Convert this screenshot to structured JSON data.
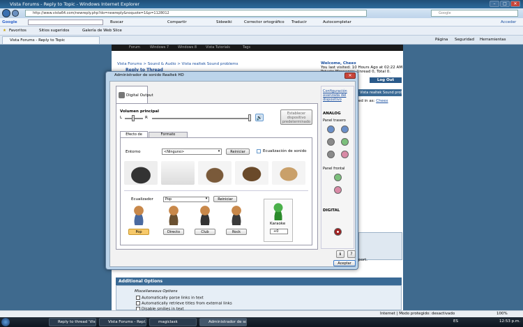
{
  "window": {
    "title": "Vista Forums - Reply to Topic - Windows Internet Explorer",
    "min": "–",
    "max": "□",
    "close": "✕"
  },
  "browser": {
    "address": "http://www.vista64.com/newreply.php?do=newreply&noquote=1&p=1128012",
    "search_placeholder": "Google",
    "google_label": "Google",
    "google_buttons": [
      "Buscar",
      "Compartir",
      "Sidewiki",
      "Corrector ortográfico",
      "Traducir",
      "Autocompletar"
    ],
    "signin": "Acceder",
    "favorites": "Favoritos",
    "sugeridos": "Sitios sugeridos",
    "galeria": "Galería de Web Slice",
    "tab_title": "Vista Forums - Reply to Topic",
    "menus": [
      "Página",
      "Seguridad",
      "Herramientas"
    ]
  },
  "forum": {
    "nav": [
      "Forum",
      "Windows 7",
      "Windows 8",
      "Vista Tutorials",
      "Tags"
    ],
    "breadcrumb": "Vista Forums > Sound & Audio > Vista realtek Sound problems",
    "reply_title": "Reply to Thread",
    "welcome": "Welcome,",
    "username": "Cheex",
    "last_visit": "You last visited: 10 Hours Ago at 02:22 AM",
    "pm": "Private Messages: Unread 0, Total 0.",
    "logout": "Log Out",
    "thread_box": "Vista realtek Sound problems",
    "logged_in": "ed in as: ",
    "logged_user": "Cheex",
    "support_frag": "port.",
    "additional": "Additional Options",
    "misc": "Miscellaneous Options",
    "options": [
      "Automatically parse links in text",
      "Automatically retrieve titles from external links",
      "Disable smilies in text"
    ]
  },
  "dialog": {
    "title": "Administrador de sonido Realtek HD",
    "device_tab": "Digital Output",
    "volume_label": "Volumen principal",
    "left": "L",
    "right": "R",
    "set_default": "Establecer dispositivo predeterminado",
    "tabs": [
      "Efecto de sonido",
      "Formato predeterminado"
    ],
    "entorno": "Entorno",
    "entorno_value": "<Ninguno>",
    "reiniciar": "Reiniciar",
    "eq_sound": "Ecualización de sonido",
    "ecualizador": "Ecualizador",
    "eq_value": "Pop",
    "presets": [
      "Pop",
      "Directo",
      "Club",
      "Rock"
    ],
    "karaoke": "Karaoke",
    "karaoke_value": "+0",
    "accept": "Aceptar",
    "advanced_link": "Configuración avanzada del dispositivo",
    "analog": "ANALOG",
    "rear_panel": "Panel trasero",
    "front_panel": "Panel frontal",
    "digital": "DIGITAL"
  },
  "statusbar": {
    "zone": "Internet | Modo protegido: desactivado",
    "zoom": "100%"
  },
  "taskbar": {
    "items": [
      "Reply to thread 'Vist...",
      "Vista Forums - Repl...",
      "magiclask",
      "Administrador de so..."
    ],
    "lang": "ES",
    "time": "12:53 p.m."
  },
  "colors": {
    "dialog_frame": "#bcd4ea",
    "jack_pink": "#d98aa6",
    "jack_green": "#7cbf7c",
    "jack_gray": "#8a8a8a",
    "jack_blue": "#6a8fc8"
  }
}
